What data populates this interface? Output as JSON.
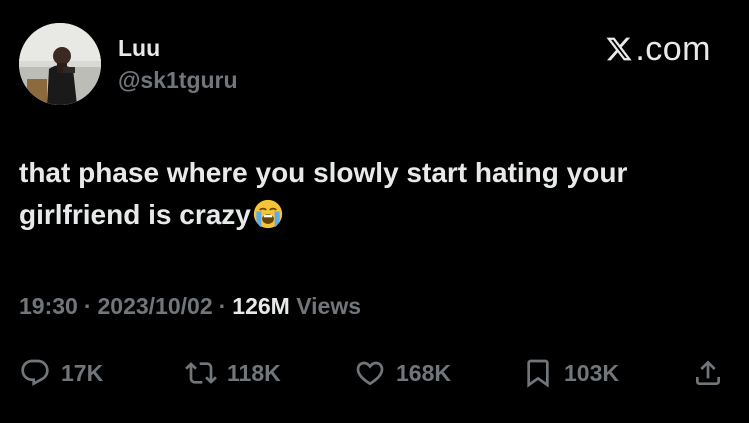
{
  "user": {
    "display_name": "Luu",
    "handle": "@sk1tguru",
    "avatar_icon": "profile-photo"
  },
  "brand": {
    "logo_icon": "x-logo-icon",
    "text": ".com"
  },
  "tweet": {
    "text": "that phase where you slowly start hating your girlfriend is crazy",
    "emoji": "loudly-crying-face"
  },
  "meta": {
    "time": "19:30",
    "separator": "·",
    "date": "2023/10/02",
    "views_count": "126M",
    "views_label": "Views"
  },
  "actions": {
    "reply": {
      "icon": "reply-icon",
      "count": "17K"
    },
    "repost": {
      "icon": "repost-icon",
      "count": "118K"
    },
    "like": {
      "icon": "heart-icon",
      "count": "168K"
    },
    "bookmark": {
      "icon": "bookmark-icon",
      "count": "103K"
    },
    "share": {
      "icon": "share-icon"
    }
  },
  "colors": {
    "background": "#000000",
    "primary_text": "#e7e9ea",
    "secondary_text": "#71767b"
  }
}
